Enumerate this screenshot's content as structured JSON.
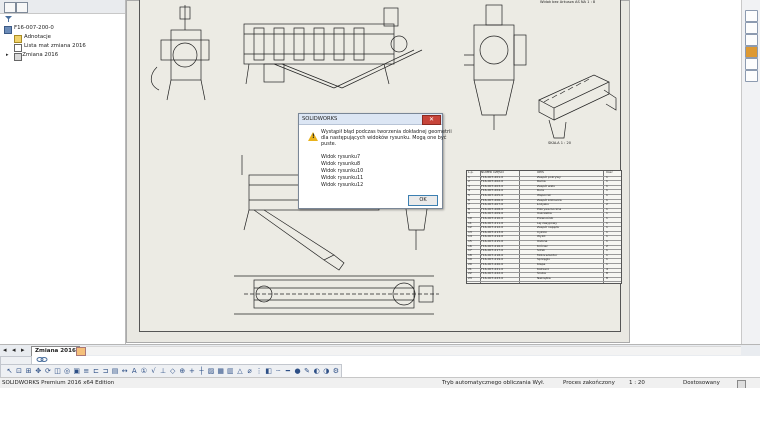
{
  "tree": {
    "root": "F16-007-200-0",
    "items": [
      {
        "label": "Adnotacje",
        "icon": "annotation-icon"
      },
      {
        "label": "Lista mat zmiana 2016",
        "icon": "material-list-icon"
      },
      {
        "label": "Zmiana 2016",
        "icon": "sheet-icon"
      }
    ]
  },
  "dialog": {
    "title": "SOLIDWORKS",
    "message_line1": "Wystąpił błąd podczas tworzenia dokładnej geometrii",
    "message_line2": "dla następujących widoków rysunku. Mogą one być",
    "message_line3": "puste.",
    "views": [
      "Widok rysunku7",
      "Widok rysunku8",
      "Widok rysunku10",
      "Widok rysunku11",
      "Widok rysunku12"
    ],
    "ok_label": "OK",
    "close_label": "✕"
  },
  "drawing": {
    "scale_label": "SKALA 1 : 20",
    "title_strip": "Widok bez Arkusza   AS  NA  1 : 8"
  },
  "bom": {
    "headers": [
      "L.p.",
      "NUMER CZĘŚCI",
      "OPIS",
      "Ilość"
    ],
    "rows": [
      [
        "1",
        "F16-007-201-0",
        "Zespół pokrywy",
        "1"
      ],
      [
        "2",
        "F16-007-202-0",
        "Rama",
        "1"
      ],
      [
        "3",
        "F16-007-203-0",
        "Zespół wału",
        "1"
      ],
      [
        "4",
        "F16-007-204-0",
        "Rura",
        "1"
      ],
      [
        "5",
        "F16-007-205-0",
        "Wspornik",
        "1"
      ],
      [
        "6",
        "F16-007-206-0",
        "Zespół kołnierza",
        "1"
      ],
      [
        "7",
        "F16-007-207-0",
        "Łożysko",
        "2"
      ],
      [
        "8",
        "F16-007-208-0",
        "Pokrywa boczna",
        "1"
      ],
      [
        "9",
        "F16-007-209-0",
        "Uszczelka",
        "1"
      ],
      [
        "10",
        "F16-007-210-0",
        "Przenośnik",
        "1"
      ],
      [
        "11",
        "F16-007-211-0",
        "Lej zasypowy",
        "1"
      ],
      [
        "12",
        "F16-007-212-0",
        "Zespół napędu",
        "1"
      ],
      [
        "13",
        "F16-007-213-0",
        "Cyklon",
        "1"
      ],
      [
        "14",
        "F16-007-214-0",
        "Wylot",
        "1"
      ],
      [
        "15",
        "F16-007-215-0",
        "Osłona",
        "1"
      ],
      [
        "16",
        "F16-007-216-0",
        "Króciec",
        "2"
      ],
      [
        "17",
        "F16-007-217-0",
        "Silnik",
        "1"
      ],
      [
        "18",
        "F16-007-218-0",
        "Motoreduktor",
        "1"
      ],
      [
        "19",
        "F16-007-219-0",
        "Sprzęgło",
        "1"
      ],
      [
        "20",
        "F16-007-220-0",
        "Klapa",
        "1"
      ],
      [
        "21",
        "F16-007-221-0",
        "Kołnierz",
        "4"
      ],
      [
        "22",
        "F16-007-222-0",
        "Śruba",
        "8"
      ],
      [
        "23",
        "F16-007-223-0",
        "Nakrętka",
        "8"
      ]
    ]
  },
  "tabbar": {
    "sheet_tab": "Zmiana 2016"
  },
  "statusbar": {
    "product": "SOLIDWORKS Premium 2016 x64 Edition",
    "rebuild_mode": "Tryb automatycznego obliczania Wył.",
    "process": "Proces zakończony",
    "scale": "1 : 20",
    "units": "Dostosowany"
  },
  "colors": {
    "sheet": "#ecebe4",
    "dialog_title": "#dce6f4",
    "close_button": "#c7443a",
    "warning": "#e9b21b"
  }
}
